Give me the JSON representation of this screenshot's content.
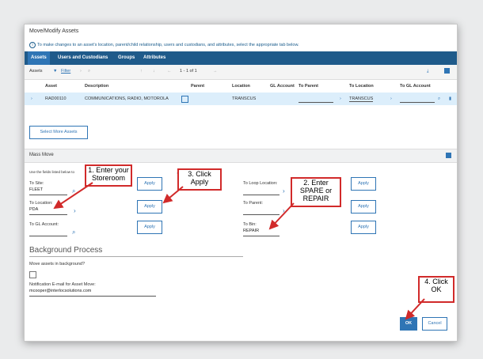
{
  "dialog": {
    "title": "Move/Modify Assets",
    "info": "To make changes to an asset's location, parent/child relationship, users and custodians, and attributes, select the appropriate tab below."
  },
  "tabs": [
    "Assets",
    "Users and Custodians",
    "Groups",
    "Attributes"
  ],
  "toolbar": {
    "label": "Assets",
    "filter": "Filter",
    "pager": "1 - 1 of 1"
  },
  "table": {
    "headers": [
      "Asset",
      "Description",
      "Parent",
      "Location",
      "GL Account",
      "To Parent",
      "To Location",
      "To GL Account"
    ],
    "row": {
      "asset": "RAD00110",
      "description": "COMMUNICATIONS, RADIO, MOTOROLA",
      "location": "TRANSCUS",
      "to_location": "TRANSCUS"
    }
  },
  "select_more": "Select More Assets",
  "mass_move": {
    "title": "Mass Move",
    "hint": "Use the fields listed below to",
    "hint_tail": ", parent, or bin for all th",
    "to_site_label": "To Site:",
    "to_site": "FLEET",
    "to_location_label": "To Location:",
    "to_location": "PDA",
    "to_gl_label": "To GL Account:",
    "to_gl": "",
    "to_loop_label": "To Loop Location:",
    "to_loop": "",
    "to_parent_label": "To Parent:",
    "to_parent": "",
    "to_bin_label": "To Bin:",
    "to_bin": "REPAIR",
    "apply": "Apply"
  },
  "background": {
    "title": "Background Process",
    "move_bg_label": "Move assets in background?",
    "email_label": "Notification E-mail for Asset Move:",
    "email": "mcooper@interlocsolutions.com"
  },
  "buttons": {
    "ok": "OK",
    "cancel": "Cancel"
  },
  "callouts": {
    "c1": "1. Enter your Storeroom",
    "c2": "3. Click Apply",
    "c3": "2. Enter SPARE or REPAIR",
    "c4": "4. Click OK"
  },
  "colors": {
    "accent": "#2f75b5",
    "tab_bar": "#1f5a8a",
    "callout": "#d12a2a",
    "row_selected": "#dceefb"
  }
}
